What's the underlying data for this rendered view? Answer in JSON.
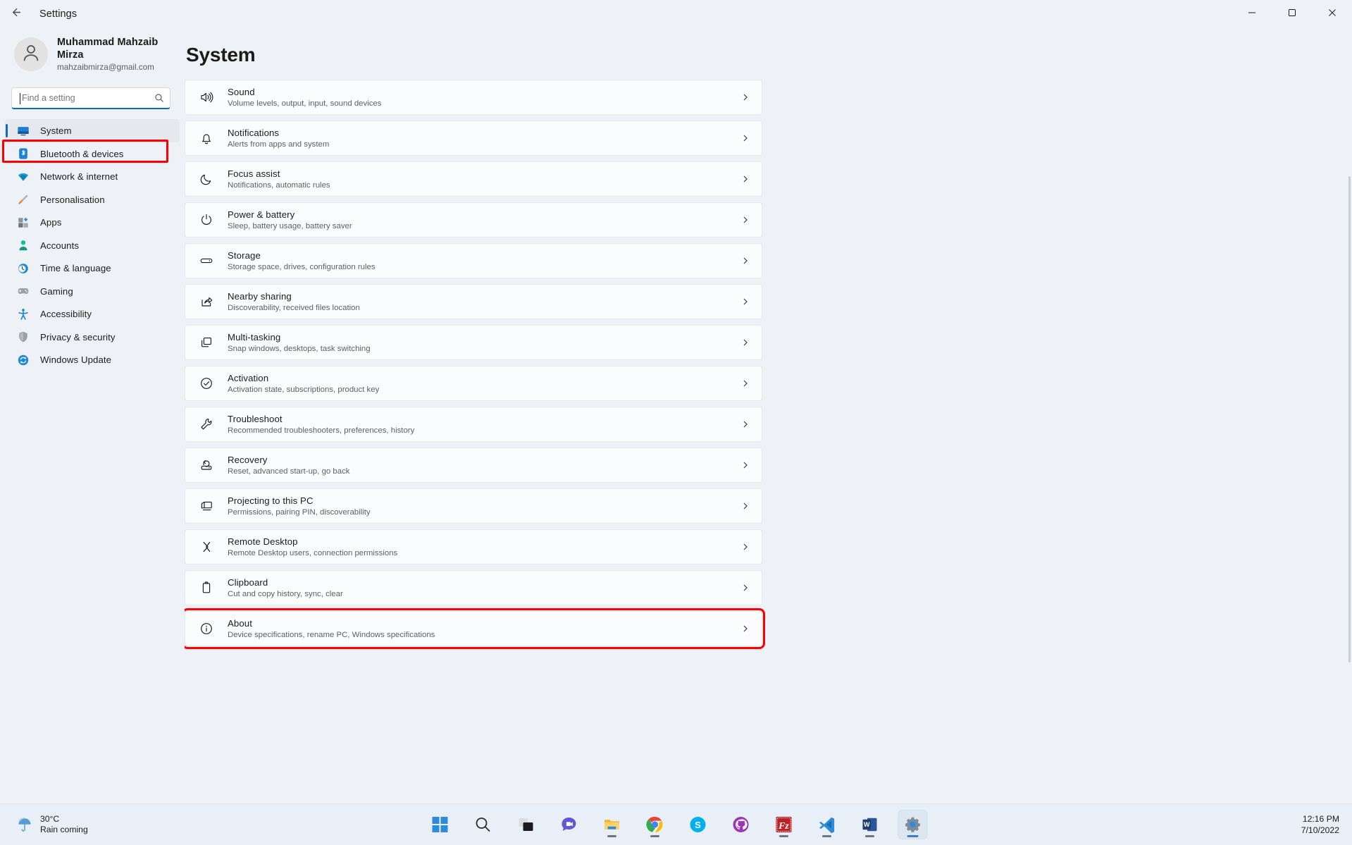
{
  "window": {
    "title": "Settings",
    "back_icon": "back-arrow-icon",
    "minimize_label": "Minimize",
    "maximize_label": "Maximize",
    "close_label": "Close"
  },
  "account": {
    "name": "Muhammad Mahzaib Mirza",
    "email": "mahzaibmirza@gmail.com",
    "avatar_icon": "person-avatar-icon"
  },
  "search": {
    "placeholder": "Find a setting",
    "value": "",
    "icon": "search-icon"
  },
  "sidebar": {
    "items": [
      {
        "label": "System",
        "icon": "monitor-icon",
        "selected": true
      },
      {
        "label": "Bluetooth & devices",
        "icon": "bluetooth-icon",
        "selected": false
      },
      {
        "label": "Network & internet",
        "icon": "wifi-icon",
        "selected": false
      },
      {
        "label": "Personalisation",
        "icon": "paintbrush-icon",
        "selected": false
      },
      {
        "label": "Apps",
        "icon": "apps-grid-icon",
        "selected": false
      },
      {
        "label": "Accounts",
        "icon": "account-icon",
        "selected": false
      },
      {
        "label": "Time & language",
        "icon": "clock-globe-icon",
        "selected": false
      },
      {
        "label": "Gaming",
        "icon": "gamepad-icon",
        "selected": false
      },
      {
        "label": "Accessibility",
        "icon": "accessibility-icon",
        "selected": false
      },
      {
        "label": "Privacy & security",
        "icon": "shield-icon",
        "selected": false
      },
      {
        "label": "Windows Update",
        "icon": "update-refresh-icon",
        "selected": false
      }
    ]
  },
  "main": {
    "page_title": "System",
    "rows": [
      {
        "title": "Sound",
        "subtitle": "Volume levels, output, input, sound devices",
        "icon": "speaker-icon",
        "highlighted": false
      },
      {
        "title": "Notifications",
        "subtitle": "Alerts from apps and system",
        "icon": "bell-icon",
        "highlighted": false
      },
      {
        "title": "Focus assist",
        "subtitle": "Notifications, automatic rules",
        "icon": "moon-icon",
        "highlighted": false
      },
      {
        "title": "Power & battery",
        "subtitle": "Sleep, battery usage, battery saver",
        "icon": "power-icon",
        "highlighted": false
      },
      {
        "title": "Storage",
        "subtitle": "Storage space, drives, configuration rules",
        "icon": "drive-icon",
        "highlighted": false
      },
      {
        "title": "Nearby sharing",
        "subtitle": "Discoverability, received files location",
        "icon": "share-icon",
        "highlighted": false
      },
      {
        "title": "Multi-tasking",
        "subtitle": "Snap windows, desktops, task switching",
        "icon": "windows-stack-icon",
        "highlighted": false
      },
      {
        "title": "Activation",
        "subtitle": "Activation state, subscriptions, product key",
        "icon": "check-circle-icon",
        "highlighted": false
      },
      {
        "title": "Troubleshoot",
        "subtitle": "Recommended troubleshooters, preferences, history",
        "icon": "wrench-icon",
        "highlighted": false
      },
      {
        "title": "Recovery",
        "subtitle": "Reset, advanced start-up, go back",
        "icon": "recovery-icon",
        "highlighted": false
      },
      {
        "title": "Projecting to this PC",
        "subtitle": "Permissions, pairing PIN, discoverability",
        "icon": "project-screen-icon",
        "highlighted": false
      },
      {
        "title": "Remote Desktop",
        "subtitle": "Remote Desktop users, connection permissions",
        "icon": "remote-desktop-icon",
        "highlighted": false
      },
      {
        "title": "Clipboard",
        "subtitle": "Cut and copy history, sync, clear",
        "icon": "clipboard-icon",
        "highlighted": false
      },
      {
        "title": "About",
        "subtitle": "Device specifications, rename PC, Windows specifications",
        "icon": "info-icon",
        "highlighted": true
      }
    ],
    "chevron_icon": "chevron-right-icon"
  },
  "taskbar": {
    "weather": {
      "temperature": "30°C",
      "description": "Rain coming",
      "icon": "rain-umbrella-icon"
    },
    "apps": [
      {
        "name": "start-button",
        "icon": "windows-logo-icon",
        "running": false,
        "active": false
      },
      {
        "name": "search-button",
        "icon": "search-icon",
        "running": false,
        "active": false
      },
      {
        "name": "task-view-button",
        "icon": "task-view-icon",
        "running": false,
        "active": false
      },
      {
        "name": "chat-button",
        "icon": "chat-icon",
        "running": false,
        "active": false
      },
      {
        "name": "file-explorer",
        "icon": "folder-icon",
        "running": true,
        "active": false
      },
      {
        "name": "google-chrome",
        "icon": "chrome-icon",
        "running": true,
        "active": false
      },
      {
        "name": "skype",
        "icon": "skype-icon",
        "running": false,
        "active": false
      },
      {
        "name": "github-desktop",
        "icon": "github-icon",
        "running": false,
        "active": false
      },
      {
        "name": "filezilla",
        "icon": "filezilla-icon",
        "running": true,
        "active": false
      },
      {
        "name": "visual-studio-code",
        "icon": "vscode-icon",
        "running": true,
        "active": false
      },
      {
        "name": "microsoft-word",
        "icon": "word-icon",
        "running": true,
        "active": false
      },
      {
        "name": "settings",
        "icon": "gear-icon",
        "running": true,
        "active": true
      }
    ],
    "clock": {
      "time": "12:16 PM",
      "date": "7/10/2022"
    }
  },
  "colors": {
    "accent": "#0f6cbd",
    "highlight": "#ff0000",
    "window_bg": "#eef2f6",
    "card_bg": "#fbfcfd"
  }
}
